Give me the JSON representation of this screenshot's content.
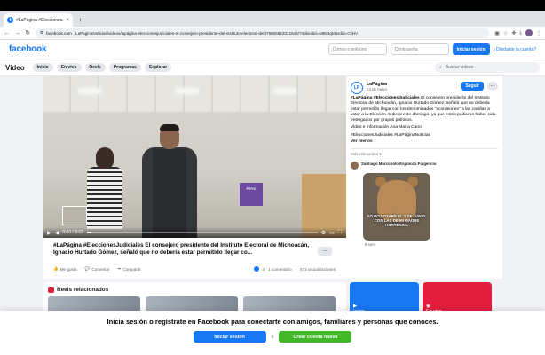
{
  "browser": {
    "tab_title": "#LaPágina #EleccionesJudic",
    "tab_favicon": "f",
    "tab_close": "×",
    "new_tab": "+",
    "url_prefix": "facebook.com",
    "url_path": "/LaPaginaNoticias/videos/lapágina-eleccionesjudiciales-el-consejero-presidente-del-instituto-electoral-de/876605822021544/?mibextid=w8EBqM&rdid=CtiHV"
  },
  "header": {
    "logo": "facebook",
    "email_placeholder": "Correo o teléfono",
    "password_placeholder": "Contraseña",
    "login_button": "Iniciar sesión",
    "forgot_link": "¿Olvidaste la cuenta?"
  },
  "subnav": {
    "title": "Video",
    "tabs": [
      "Inicio",
      "En vivo",
      "Reels",
      "Programas",
      "Explorar"
    ],
    "search_placeholder": "Buscar videos"
  },
  "video": {
    "time": "0:00 / 3:02",
    "progress": 0.02,
    "stand_label": "PEYC"
  },
  "post": {
    "caption": "#LaPágina #EleccionesJudiciales El consejero presidente del Instituto Electoral de Michoacán, Ignacio Hurtado Gómez, señaló que no debería estar permitido llegar co...",
    "more_label": "...",
    "actions": [
      "Me gusta",
      "Comentar",
      "Compartir"
    ],
    "reactions_count": "4",
    "comments_count": "1 comentario",
    "views_count": "572 visualizaciones"
  },
  "side": {
    "page_name": "LaPágina",
    "page_date": "24 de mayo",
    "follow_button": "Seguir",
    "more_button": "...",
    "description_lead": "#LaPágina #EleccionesJudiciales",
    "description_1": " El consejero presidente del Instituto Electoral de Michoacán, Ignacio Hurtado Gómez, señaló que no debería estar permitido llegar con los denominados \"acordeones\" a las casillas a votar a la Elección Judicial este domingo, ya que estos pudieran haber sido entregados por grupos políticos.",
    "description_2": "Video e información Ana María Cano",
    "description_3": "#EleccionesJudiciales #LaPáginaNoticias",
    "see_less": "Ver menos",
    "relevant": "Más relevantes ▾",
    "commenter": "Santiago Marcopolo Espinoza Fulgencio",
    "meme_text": "YO NO VOTARÉ EL 1 DE JUNIO, CON LAS DE MI MADRE HORTENSIA",
    "comment_time": "6 sem"
  },
  "bottom": {
    "reels_title": "Reels relacionados",
    "tile_home": "Inicio",
    "tile_live": "En vivo"
  },
  "banner": {
    "text": "Inicia sesión o regístrate en Facebook para conectarte con amigos, familiares y personas que conoces.",
    "login": "Iniciar sesión",
    "or": "o",
    "create": "Crear cuenta nueva"
  },
  "colors": {
    "brand": "#1877f2",
    "create": "#42b72a",
    "live": "#e41e3f"
  }
}
